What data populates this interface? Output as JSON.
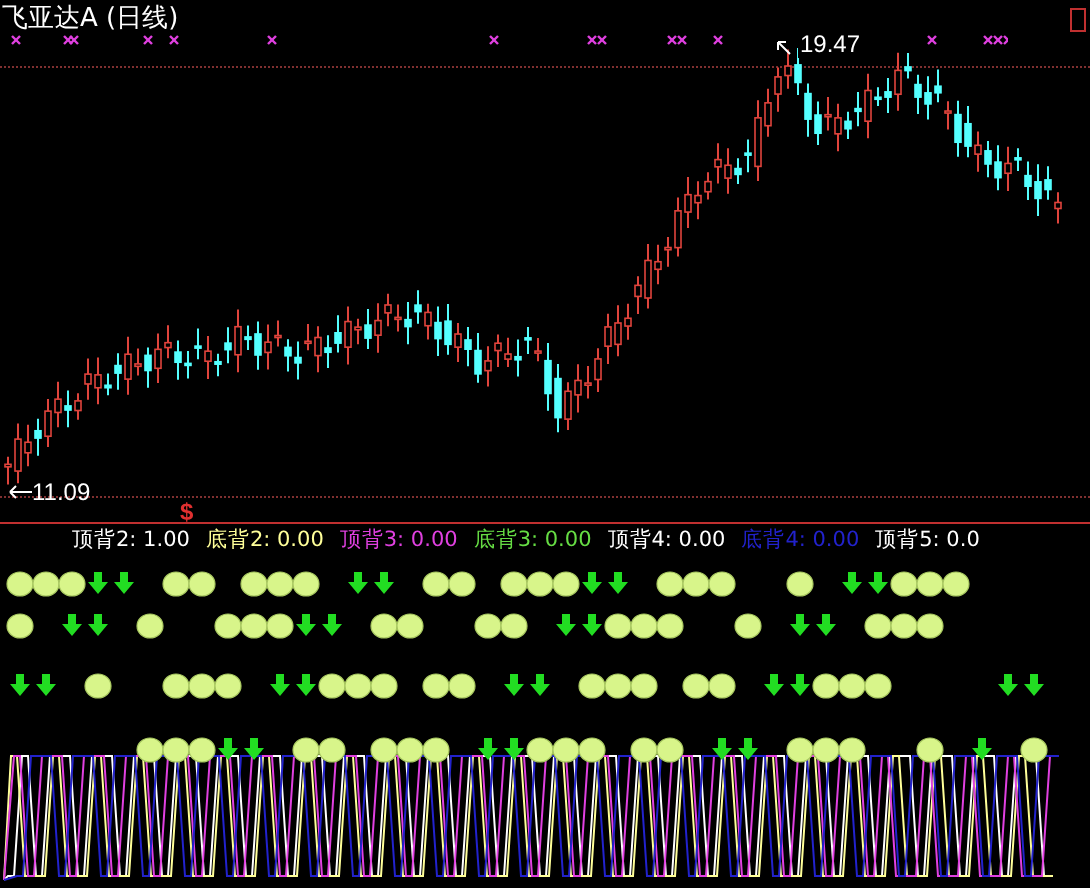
{
  "title": "飞亚达A (日线)",
  "price_chart": {
    "high_label": "19.47",
    "low_label": "11.09",
    "signal_mark": "$"
  },
  "indicator": {
    "values": [
      {
        "label": "顶背2: 1.00",
        "color": "#ffffff"
      },
      {
        "label": "底背2: 0.00",
        "color": "#ffff99"
      },
      {
        "label": "顶背3: 0.00",
        "color": "#e040e0"
      },
      {
        "label": "底背3: 0.00",
        "color": "#66dd44"
      },
      {
        "label": "顶背4: 0.00",
        "color": "#ffffff"
      },
      {
        "label": "底背4: 0.00",
        "color": "#2222cc"
      },
      {
        "label": "顶背5: 0.0",
        "color": "#ffffff"
      }
    ]
  }
}
